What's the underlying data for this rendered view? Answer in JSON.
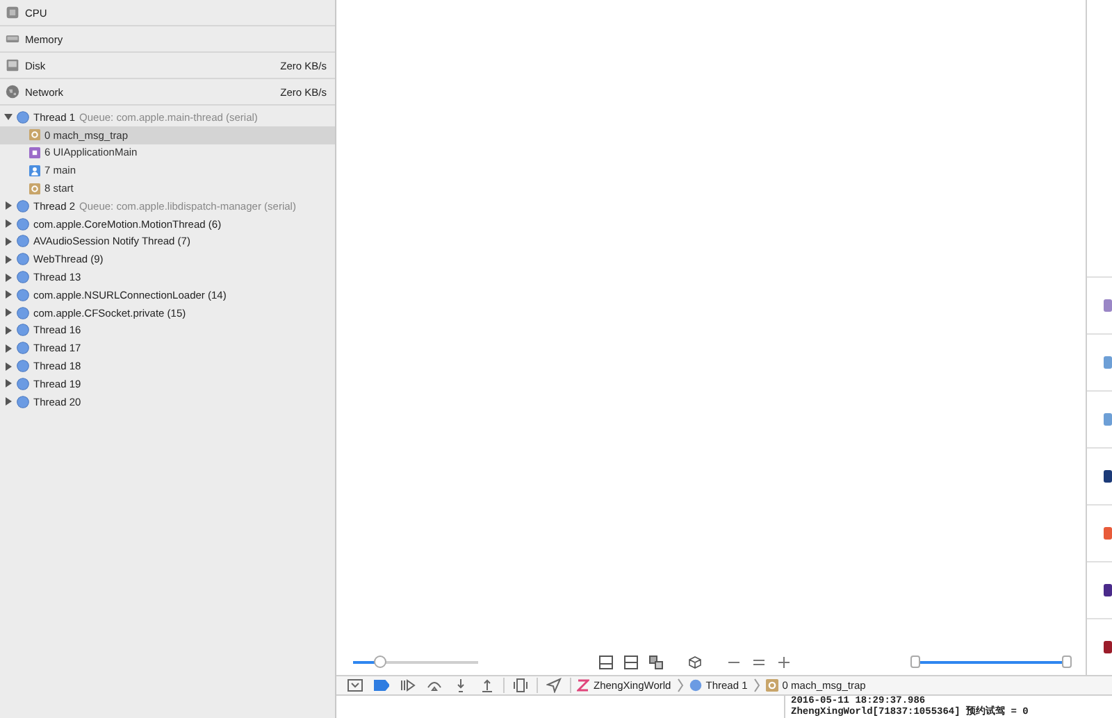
{
  "gauges": [
    {
      "kind": "cpu",
      "label": "CPU"
    },
    {
      "kind": "memory",
      "label": "Memory"
    },
    {
      "kind": "disk",
      "label": "Disk",
      "value": "Zero KB/s"
    },
    {
      "kind": "network",
      "label": "Network",
      "value": "Zero KB/s"
    }
  ],
  "threads": [
    {
      "name": "Thread 1",
      "queue": "Queue: com.apple.main-thread (serial)",
      "expanded": true,
      "frames": [
        {
          "kind": "system",
          "label": "0 mach_msg_trap",
          "selected": true
        },
        {
          "kind": "framework",
          "label": "6 UIApplicationMain",
          "selected": false
        },
        {
          "kind": "user",
          "label": "7 main",
          "selected": false
        },
        {
          "kind": "system",
          "label": "8 start",
          "selected": false
        }
      ]
    },
    {
      "name": "Thread 2",
      "queue": "Queue: com.apple.libdispatch-manager (serial)",
      "expanded": false
    },
    {
      "name": "com.apple.CoreMotion.MotionThread (6)",
      "expanded": false
    },
    {
      "name": "AVAudioSession Notify Thread (7)",
      "expanded": false
    },
    {
      "name": "WebThread (9)",
      "expanded": false
    },
    {
      "name": "Thread 13",
      "expanded": false
    },
    {
      "name": "com.apple.NSURLConnectionLoader (14)",
      "expanded": false
    },
    {
      "name": "com.apple.CFSocket.private (15)",
      "expanded": false
    },
    {
      "name": "Thread 16",
      "expanded": false
    },
    {
      "name": "Thread 17",
      "expanded": false
    },
    {
      "name": "Thread 18",
      "expanded": false
    },
    {
      "name": "Thread 19",
      "expanded": false
    },
    {
      "name": "Thread 20",
      "expanded": false
    }
  ],
  "canvas_toolbar": {
    "zoom_slider": {
      "level": 0.22
    },
    "range_slider": {
      "level": 1
    }
  },
  "debug_bar": {
    "breakpoints_on": true,
    "breadcrumbs": [
      {
        "kind": "app",
        "label": "ZhengXingWorld"
      },
      {
        "kind": "thread",
        "label": "Thread 1"
      },
      {
        "kind": "frame",
        "label": "0 mach_msg_trap"
      }
    ]
  },
  "console": {
    "lines": [
      "2016-05-11 18:29:37.986",
      "ZhengXingWorld[71837:1055364] 预约试驾 = 0"
    ]
  }
}
